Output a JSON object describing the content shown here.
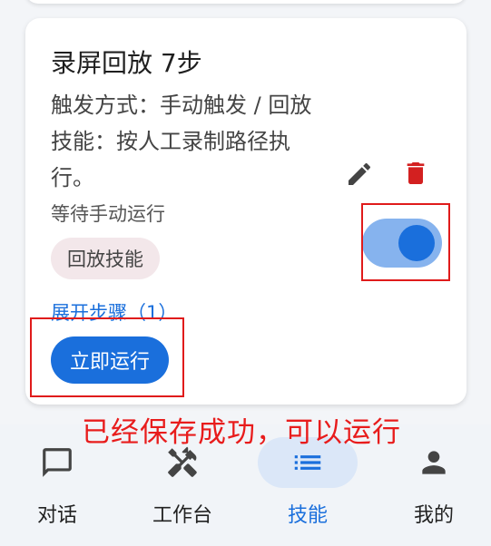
{
  "card": {
    "title": "录屏回放 7步",
    "description": "触发方式：手动触发 / 回放技能：按人工录制路径执行。",
    "status": "等待手动运行",
    "chip": "回放技能",
    "toggle_enabled": true,
    "expand_label": "展开步骤（1）",
    "run_label": "立即运行"
  },
  "annotation": "已经保存成功，可以运行",
  "icons": {
    "edit": "pencil-icon",
    "delete": "trash-icon",
    "chat": "chat-bubble-icon",
    "workbench": "tools-icon",
    "skills": "list-icon",
    "me": "person-icon"
  },
  "colors": {
    "accent": "#1a6fdc",
    "delete": "#d32020",
    "annotation": "#e81c1c"
  },
  "nav": {
    "items": [
      {
        "label": "对话",
        "active": false
      },
      {
        "label": "工作台",
        "active": false
      },
      {
        "label": "技能",
        "active": true
      },
      {
        "label": "我的",
        "active": false
      }
    ]
  }
}
